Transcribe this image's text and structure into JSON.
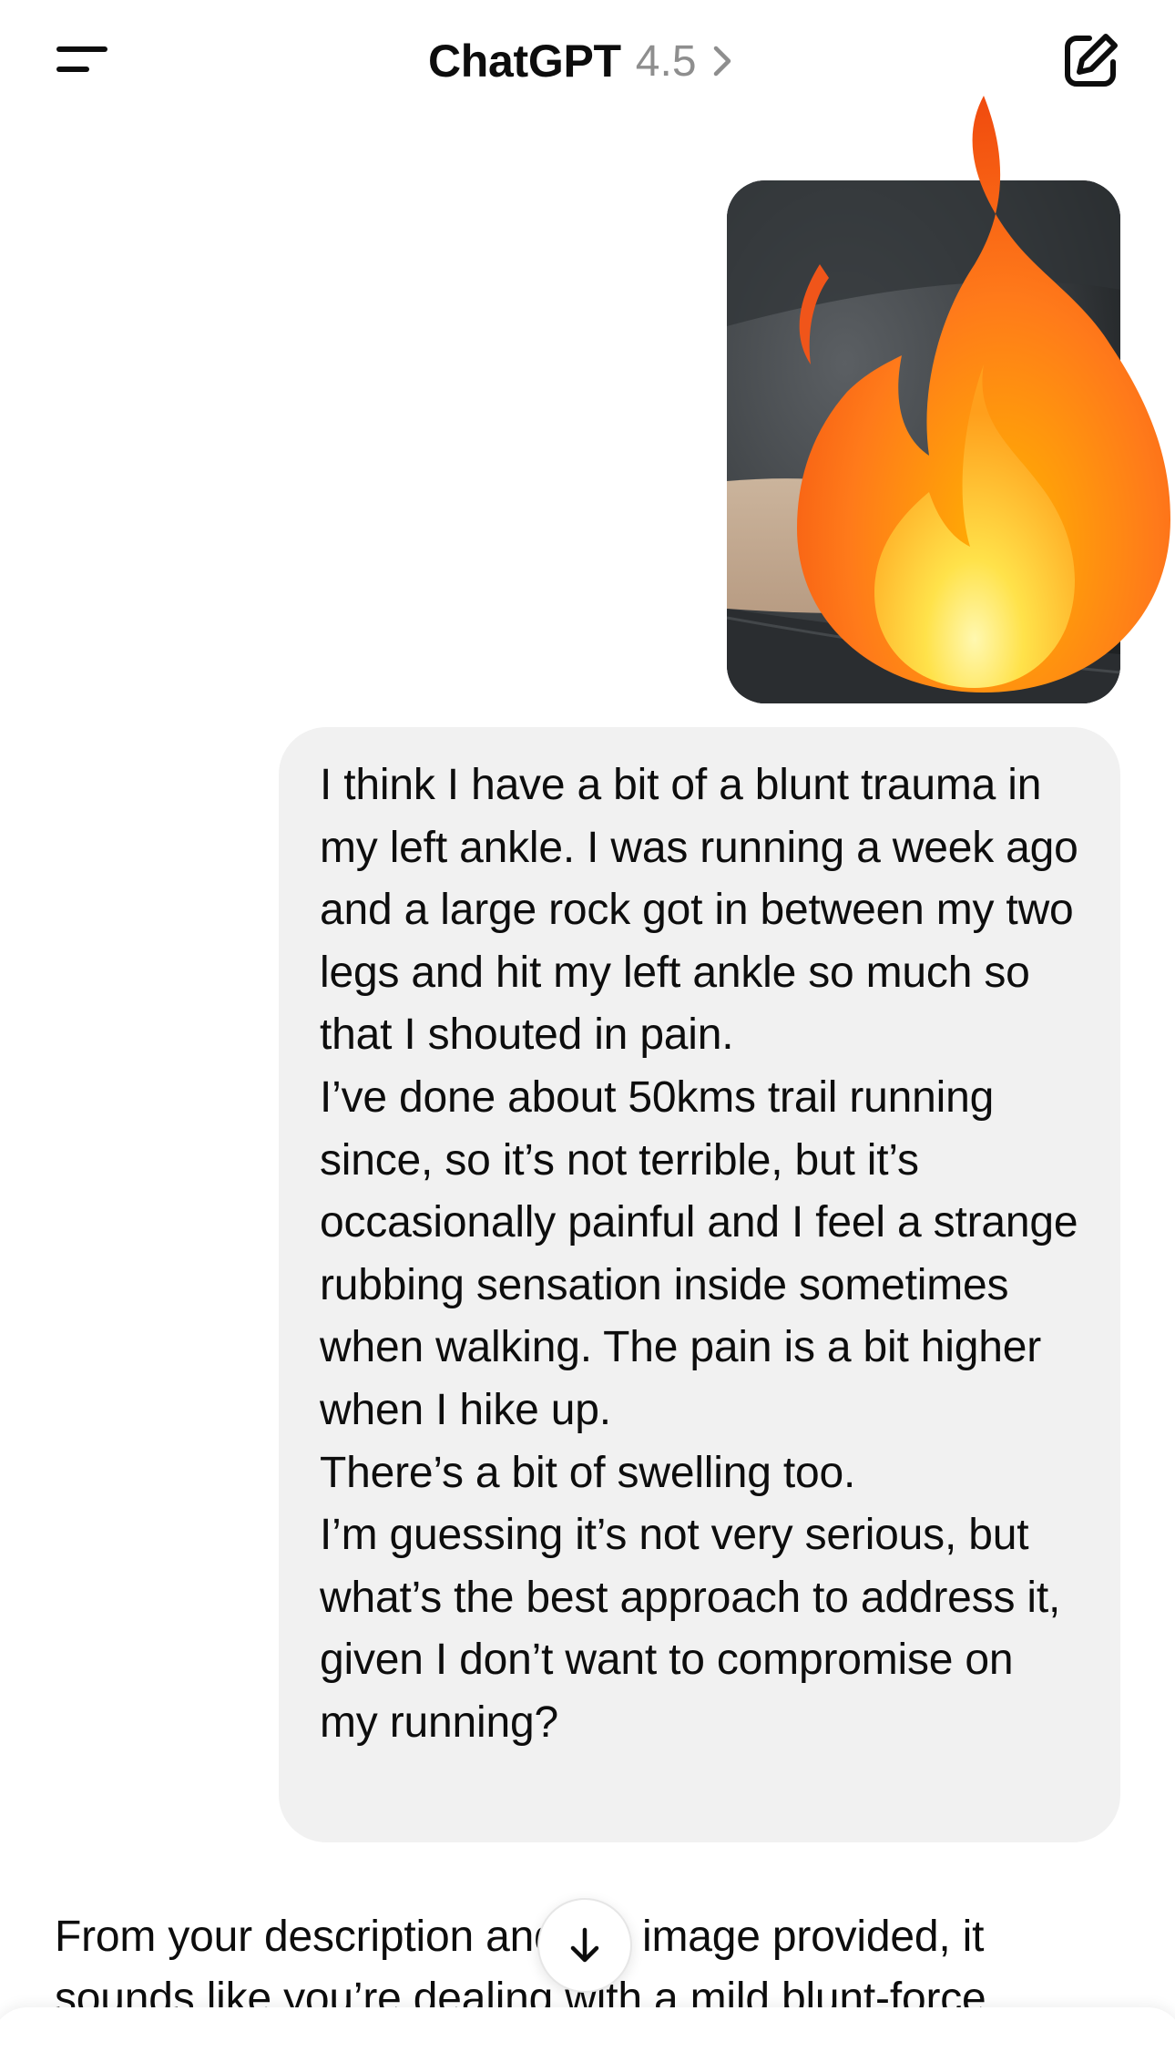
{
  "header": {
    "model_name": "ChatGPT",
    "model_version": "4.5",
    "menu_icon": "menu-icon",
    "chevron_icon": "chevron-right-icon",
    "new_chat_icon": "new-chat-icon"
  },
  "conversation": {
    "user_attachment_icon": "ankle-photo",
    "sticker_icon": "fire-emoji",
    "user_message": "I think I have a bit of a blunt trauma in my left ankle. I was running a week ago and a large rock got in between my two legs and hit my left ankle so much so that I shouted in pain.\nI’ve done about 50kms trail running since, so it’s not terrible, but it’s occasionally painful and I feel a strange rubbing sensation inside sometimes when walking. The pain is a bit higher when I hike up.\nThere’s a bit of swelling too.\nI’m guessing it’s not very serious, but what’s the best approach to address it, given I don’t want to compromise on my running?",
    "assistant_message": "From your description and the image provided, it sounds like you’re dealing with a mild blunt-force"
  },
  "scroll_button": {
    "icon": "arrow-down-icon"
  },
  "colors": {
    "text": "#0d0d0d",
    "muted": "#8e8e8e",
    "bubble": "#f1f1f1",
    "background": "#ffffff"
  }
}
